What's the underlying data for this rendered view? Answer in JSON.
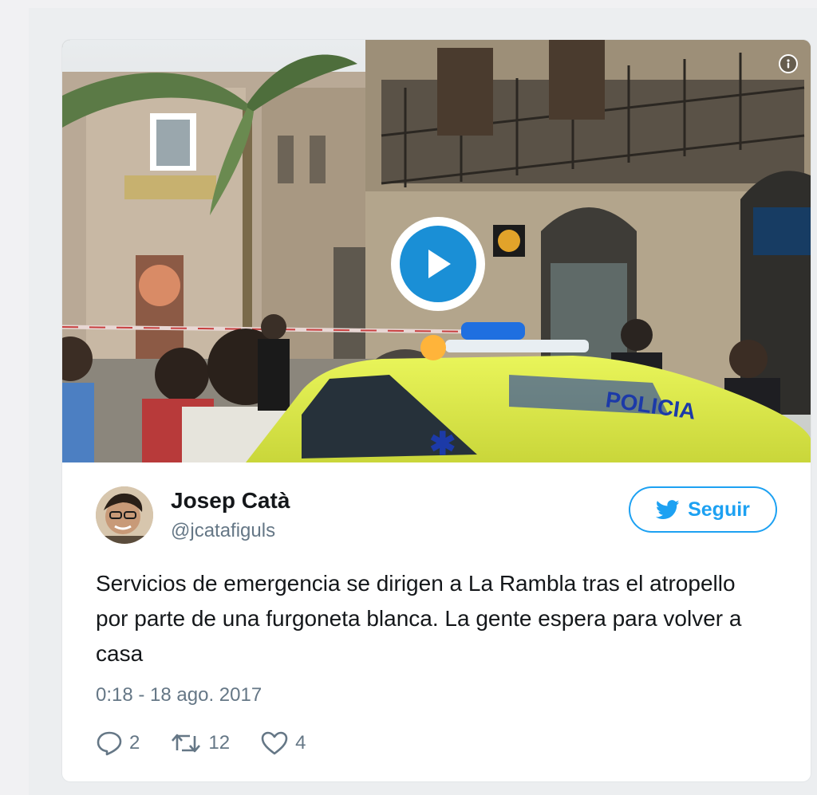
{
  "video": {
    "play_label": "Play video",
    "info_label": "Video information"
  },
  "author": {
    "name": "Josep Catà",
    "handle": "@jcatafiguls"
  },
  "follow_button": {
    "label": "Seguir"
  },
  "tweet": {
    "text": "Servicios de emergencia se dirigen a La Rambla tras el atropello por parte de una furgoneta blanca. La gente espera para volver a casa",
    "timestamp": "0:18 - 18 ago. 2017"
  },
  "stats": {
    "replies": "2",
    "retweets": "12",
    "likes": "4"
  },
  "icons": {
    "play": "play-icon",
    "info": "info-icon",
    "bird": "twitter-bird-icon",
    "reply": "reply-icon",
    "retweet": "retweet-icon",
    "like": "heart-icon"
  },
  "colors": {
    "accent": "#1da1f2",
    "play_button": "#1a8fd6",
    "text": "#14171a",
    "secondary_text": "#657786"
  }
}
